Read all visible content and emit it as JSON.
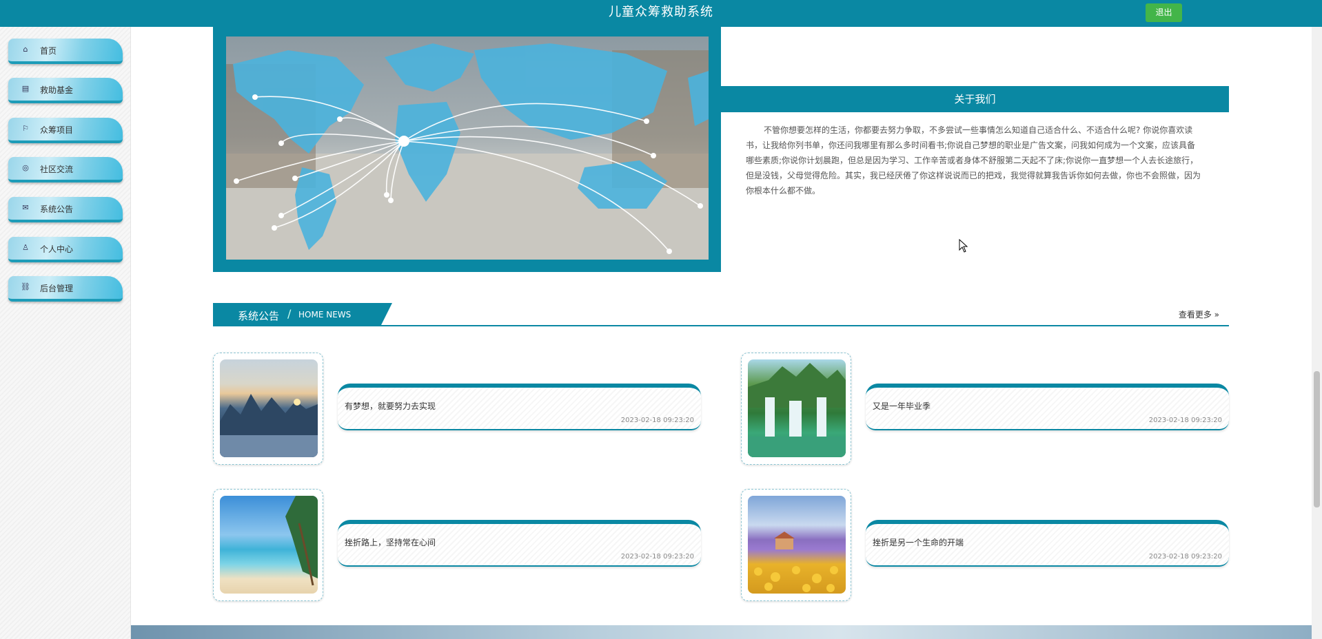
{
  "header": {
    "title": "儿童众筹救助系统",
    "logout_label": "退出"
  },
  "sidebar": {
    "items": [
      {
        "label": "首页",
        "icon": "home-icon"
      },
      {
        "label": "救助基金",
        "icon": "fund-icon"
      },
      {
        "label": "众筹项目",
        "icon": "flag-icon"
      },
      {
        "label": "社区交流",
        "icon": "chat-icon"
      },
      {
        "label": "系统公告",
        "icon": "mail-icon"
      },
      {
        "label": "个人中心",
        "icon": "user-icon"
      },
      {
        "label": "后台管理",
        "icon": "link-icon"
      }
    ]
  },
  "about": {
    "title": "关于我们",
    "text": "不管你想要怎样的生活，你都要去努力争取，不多尝试一些事情怎么知道自己适合什么、不适合什么呢? 你说你喜欢读书，让我给你列书单，你还问我哪里有那么多时间看书;你说自己梦想的职业是广告文案，问我如何成为一个文案，应该具备哪些素质;你说你计划晨跑，但总是因为学习、工作辛苦或者身体不舒服第二天起不了床;你说你一直梦想一个人去长途旅行，但是没钱，父母觉得危险。其实，我已经厌倦了你这样说说而已的把戏，我觉得就算我告诉你如何去做，你也不会照做，因为你根本什么都不做。"
  },
  "news": {
    "title": "系统公告",
    "subtitle": "HOME NEWS",
    "more_label": "查看更多",
    "items": [
      {
        "title": "有梦想，就要努力去实现",
        "date": "2023-02-18 09:23:20"
      },
      {
        "title": "又是一年毕业季",
        "date": "2023-02-18 09:23:20"
      },
      {
        "title": "挫折路上，坚持常在心间",
        "date": "2023-02-18 09:23:20"
      },
      {
        "title": "挫折是另一个生命的开端",
        "date": "2023-02-18 09:23:20"
      }
    ]
  }
}
